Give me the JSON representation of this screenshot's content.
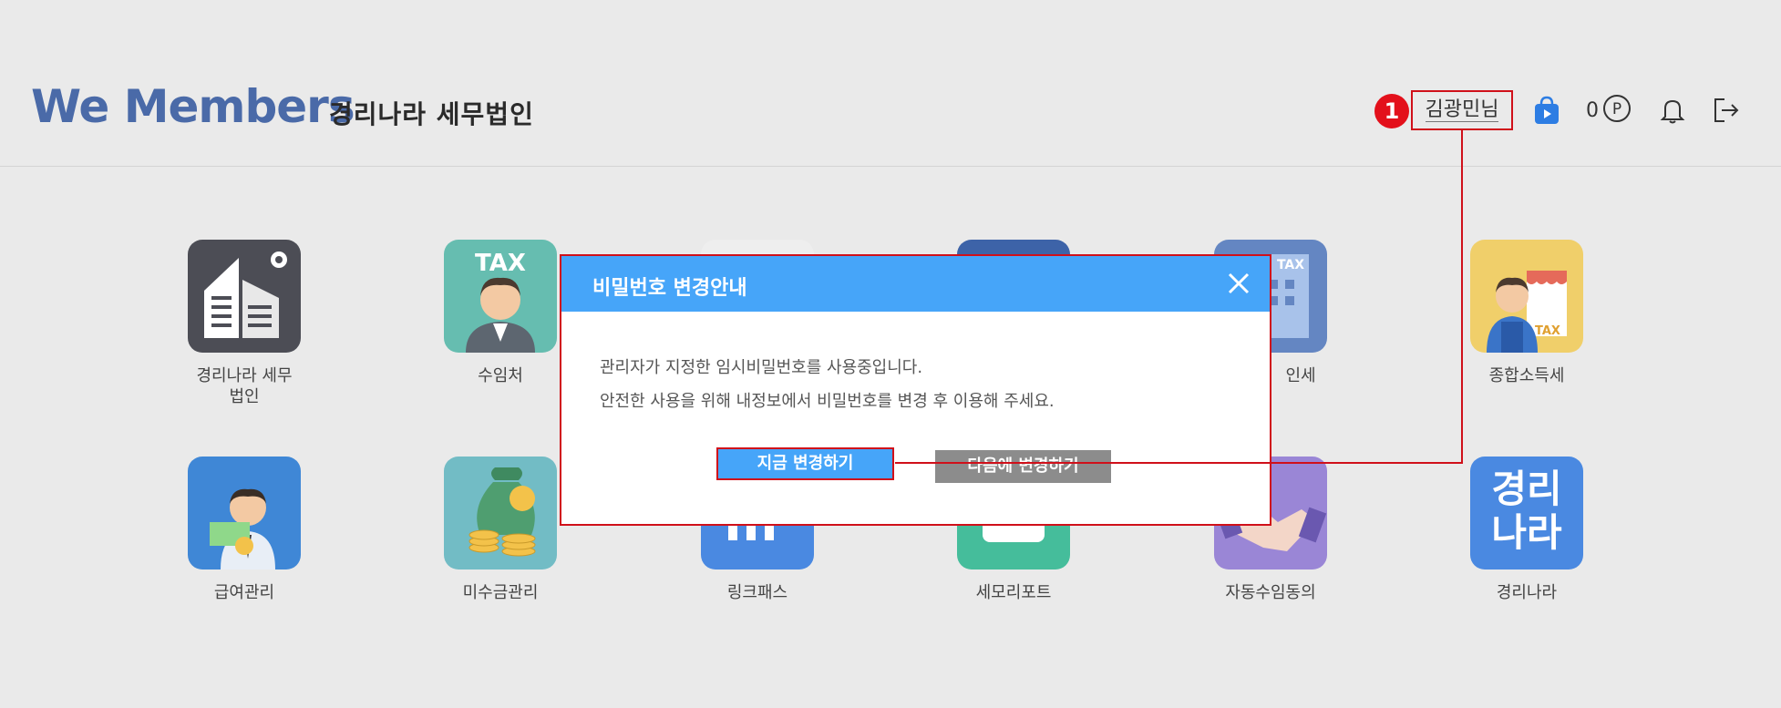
{
  "header": {
    "logo": "We Members",
    "company": "경리나라 세무법인",
    "annotation_number": "1",
    "user_name": "김광민님",
    "points_value": "0",
    "points_symbol": "P"
  },
  "apps": [
    {
      "label": "경리나라 세무\n법인",
      "icon": "building-gear-icon",
      "color": "#4c4d55"
    },
    {
      "label": "수임처",
      "icon": "tax-person-icon",
      "color": "#66bdb0",
      "text": "TAX"
    },
    {
      "label": "",
      "icon": "hidden-app-icon",
      "color": "#eeeeee"
    },
    {
      "label": "",
      "icon": "hidden-app-icon",
      "color": "#3d63a8"
    },
    {
      "label": "인세",
      "icon": "tax-building-icon",
      "color": "#6486c2",
      "text": "TAX"
    },
    {
      "label": "종합소득세",
      "icon": "shopkeeper-icon",
      "color": "#f0cf6a",
      "text": "TAX"
    },
    {
      "label": "급여관리",
      "icon": "payroll-person-icon",
      "color": "#3f87d6"
    },
    {
      "label": "미수금관리",
      "icon": "money-bag-icon",
      "color": "#72bcc5"
    },
    {
      "label": "링크패스",
      "icon": "linkpass-icon",
      "color": "#4a89e1"
    },
    {
      "label": "세모리포트",
      "icon": "report-icon",
      "color": "#45bd9b"
    },
    {
      "label": "자동수임동의",
      "icon": "handshake-icon",
      "color": "#9a86d6"
    },
    {
      "label": "경리나라",
      "icon": "gyeongrinara-icon",
      "color": "#4a89e1",
      "text": "경리\n나라"
    }
  ],
  "modal": {
    "title": "비밀번호 변경안내",
    "line1": "관리자가 지정한 임시비밀번호를 사용중입니다.",
    "line2": "안전한 사용을 위해 내정보에서 비밀번호를 변경 후 이용해 주세요.",
    "btn_now": "지금 변경하기",
    "btn_later": "다음에 변경하기"
  },
  "colors": {
    "accent": "#46a5f9",
    "highlight": "#d0101a",
    "logo": "#4a6aa8"
  }
}
